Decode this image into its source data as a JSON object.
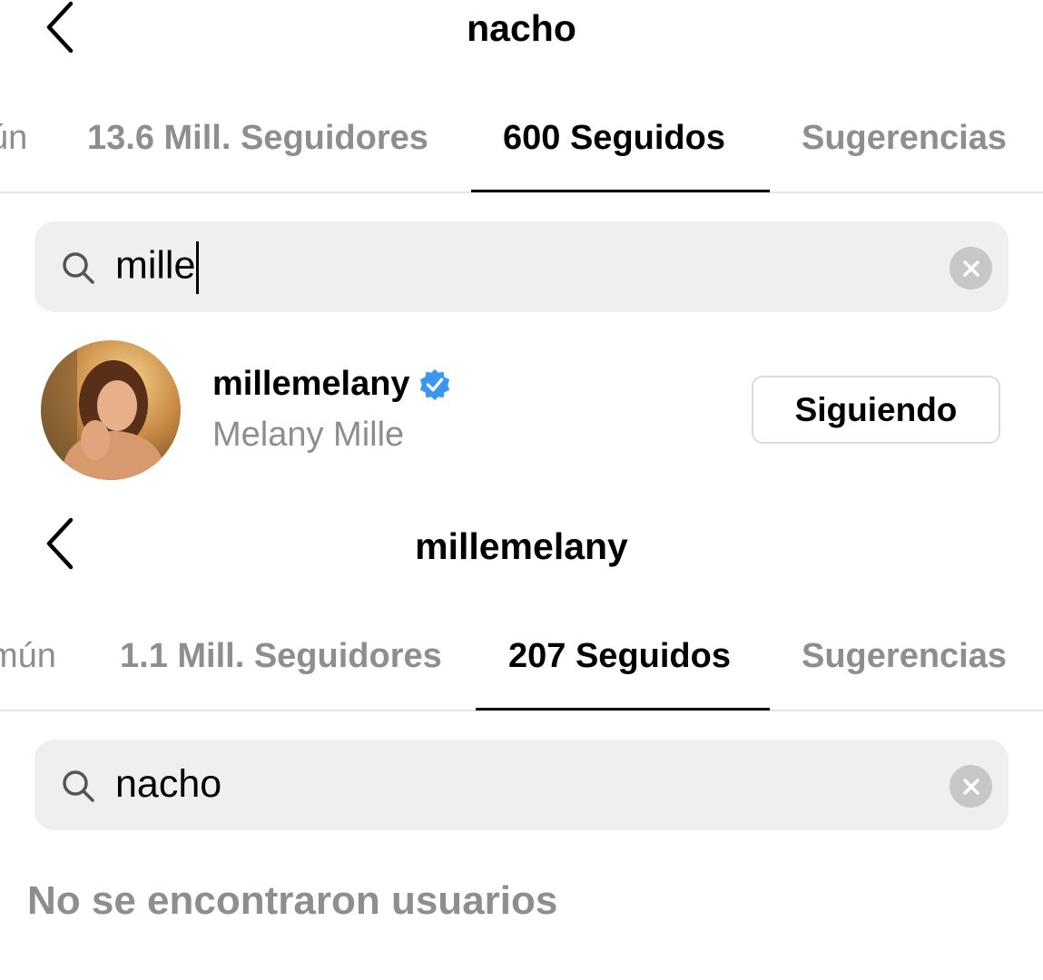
{
  "screen1": {
    "title": "nacho",
    "tabs": [
      {
        "label": "ún"
      },
      {
        "label": "13.6 Mill. Seguidores"
      },
      {
        "label": "600 Seguidos"
      },
      {
        "label": "Sugerencias"
      }
    ],
    "search": {
      "value": "mille"
    },
    "result": {
      "username": "millemelany",
      "full_name": "Melany Mille",
      "button_label": "Siguiendo",
      "verified": true
    }
  },
  "screen2": {
    "title": "millemelany",
    "tabs": [
      {
        "label": "mún"
      },
      {
        "label": "1.1 Mill. Seguidores"
      },
      {
        "label": "207 Seguidos"
      },
      {
        "label": "Sugerencias"
      }
    ],
    "search": {
      "value": "nacho"
    },
    "empty_message": "No se encontraron usuarios"
  },
  "colors": {
    "verified_badge": "#3897f0",
    "secondary_text": "#8e8e8e",
    "search_bg": "#efefef"
  }
}
